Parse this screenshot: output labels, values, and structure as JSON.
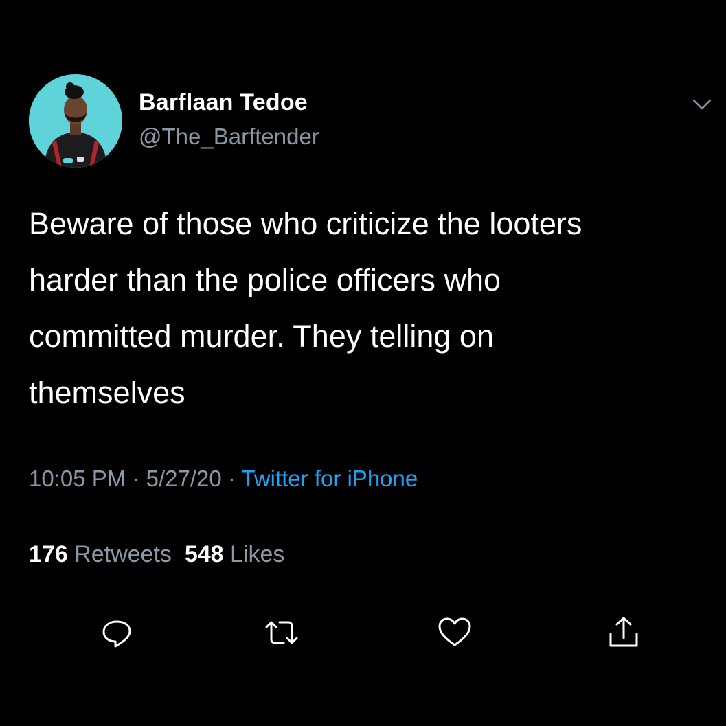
{
  "author": {
    "name": "Barflaan Tedoe",
    "handle": "@The_Barftender"
  },
  "tweet": {
    "text_lines": [
      "Beware of those who criticize the looters",
      "harder than the police officers who",
      "committed murder. They telling on",
      "themselves"
    ]
  },
  "meta": {
    "time": "10:05 PM",
    "separator": "·",
    "date": "5/27/20",
    "source": "Twitter for iPhone"
  },
  "stats": {
    "retweets_count": "176",
    "retweets_label": "Retweets",
    "likes_count": "548",
    "likes_label": "Likes"
  },
  "icons": {
    "menu": "chevron-down-icon",
    "reply": "reply-icon",
    "retweet": "retweet-icon",
    "like": "heart-icon",
    "share": "share-icon"
  },
  "colors": {
    "background": "#000000",
    "text_primary": "#ffffff",
    "text_secondary": "#8b98a5",
    "link": "#1da1f2",
    "divider": "#2f3336",
    "avatar_bg": "#5ed3d9"
  }
}
